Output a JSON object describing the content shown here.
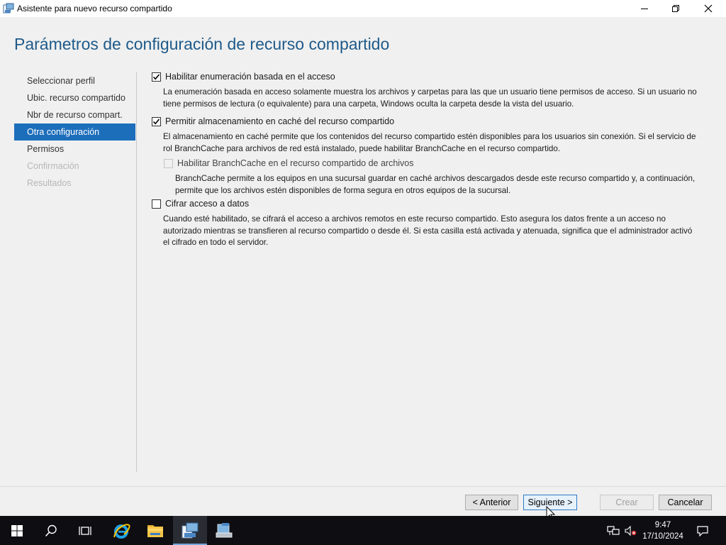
{
  "window": {
    "title": "Asistente para nuevo recurso compartido",
    "heading": "Parámetros de configuración de recurso compartido"
  },
  "nav": {
    "items": [
      {
        "label": "Seleccionar perfil",
        "state": "normal"
      },
      {
        "label": "Ubic. recurso compartido",
        "state": "normal"
      },
      {
        "label": "Nbr de recurso compart.",
        "state": "normal"
      },
      {
        "label": "Otra configuración",
        "state": "active"
      },
      {
        "label": "Permisos",
        "state": "normal"
      },
      {
        "label": "Confirmación",
        "state": "disabled"
      },
      {
        "label": "Resultados",
        "state": "disabled"
      }
    ]
  },
  "options": {
    "abe": {
      "label": "Habilitar enumeración basada en el acceso",
      "checked": true,
      "desc_line1": "La enumeración basada en acceso solamente muestra los archivos y carpetas para las que un usuario tiene permisos de acceso. Si un usuario no",
      "desc_line2": "tiene permisos de lectura (o equivalente) para una carpeta, Windows oculta la carpeta desde la vista del usuario."
    },
    "caching": {
      "label": "Permitir almacenamiento en caché del recurso compartido",
      "checked": true,
      "desc_line1": "El almacenamiento en caché permite que los contenidos del recurso compartido estén disponibles para los usuarios sin conexión. Si el servicio de",
      "desc_line2": "rol BranchCache para archivos de red está instalado, puede habilitar BranchCache en el recurso compartido."
    },
    "branchcache": {
      "label": "Habilitar BranchCache en el recurso compartido de archivos",
      "checked": false,
      "enabled": false,
      "desc_line1": "BranchCache permite a los equipos en una sucursal guardar en caché archivos descargados desde este recurso compartido y, a continuación,",
      "desc_line2": "permite que los archivos estén disponibles de forma segura en otros equipos de la sucursal."
    },
    "encrypt": {
      "label": "Cifrar acceso a datos",
      "checked": false,
      "desc_line1": "Cuando esté habilitado, se cifrará el acceso a archivos remotos en este recurso compartido. Esto asegura los datos frente a un acceso no",
      "desc_line2": "autorizado mientras se transfieren al recurso compartido o desde él. Si esta casilla está activada y atenuada, significa que el administrador activó",
      "desc_line3": "el cifrado en todo el servidor."
    }
  },
  "buttons": {
    "previous": "< Anterior",
    "next": "Siguiente >",
    "create": "Crear",
    "cancel": "Cancelar"
  },
  "taskbar": {
    "apps": [
      "windows-start",
      "search",
      "task-view",
      "internet-explorer",
      "file-explorer",
      "new-share-wizard",
      "server-manager"
    ],
    "active_app": "new-share-wizard",
    "time": "9:47",
    "date": "17/10/2024"
  },
  "colors": {
    "heading": "#1e5a8a",
    "nav_active_bg": "#1c6ebb",
    "primary_button_border": "#2f79c7",
    "taskbar_bg": "#0d0d12"
  }
}
